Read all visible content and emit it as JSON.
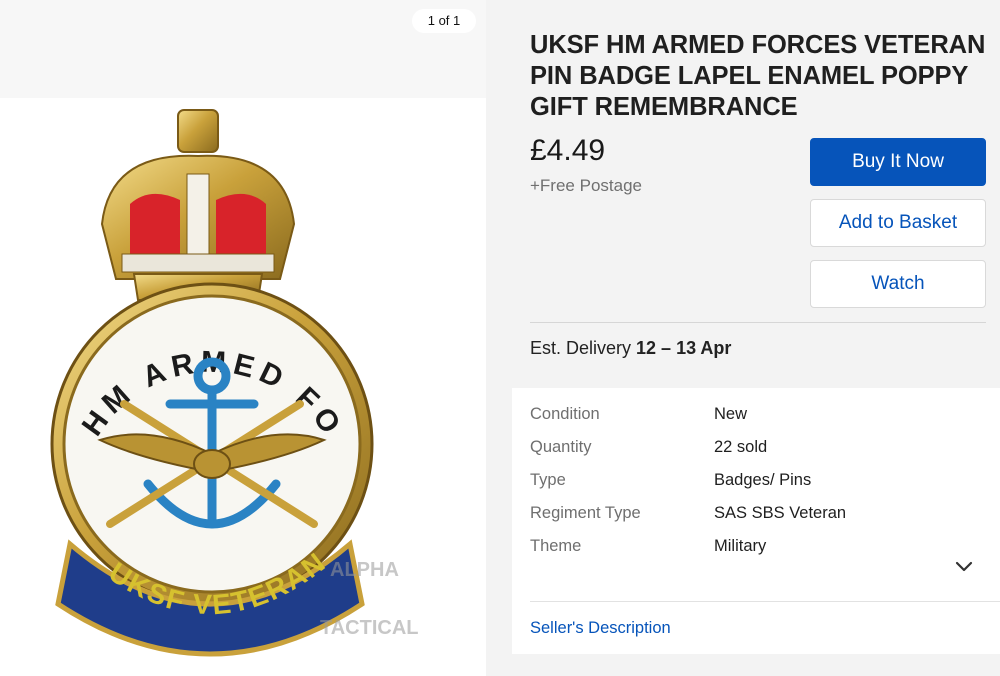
{
  "gallery": {
    "counter": "1 of 1",
    "badge": {
      "ring_text": "HM ARMED FORCES",
      "scroll_text": "UKSF VETERAN",
      "watermark_top": "ALPHA",
      "watermark_bottom": "TACTICAL"
    }
  },
  "listing": {
    "title": "UKSF HM ARMED FORCES VETERAN PIN BADGE LAPEL ENAMEL POPPY GIFT REMEMBRANCE",
    "price": "£4.49",
    "postage": "+Free Postage",
    "buy_label": "Buy It Now",
    "basket_label": "Add to Basket",
    "watch_label": "Watch",
    "delivery_prefix": "Est. Delivery ",
    "delivery_dates": "12 – 13 Apr"
  },
  "specifics": {
    "rows": [
      {
        "label": "Condition",
        "value": "New"
      },
      {
        "label": "Quantity",
        "value": "22 sold"
      },
      {
        "label": "Type",
        "value": "Badges/ Pins"
      },
      {
        "label": "Regiment Type",
        "value": "SAS SBS Veteran"
      },
      {
        "label": "Theme",
        "value": "Military"
      }
    ],
    "seller_link": "Seller's Description"
  },
  "colors": {
    "accent": "#0654ba",
    "gold": "#c9a13b",
    "crown_red": "#d8232a",
    "scroll_blue": "#1f3d8a",
    "anchor_blue": "#2a83c4"
  }
}
